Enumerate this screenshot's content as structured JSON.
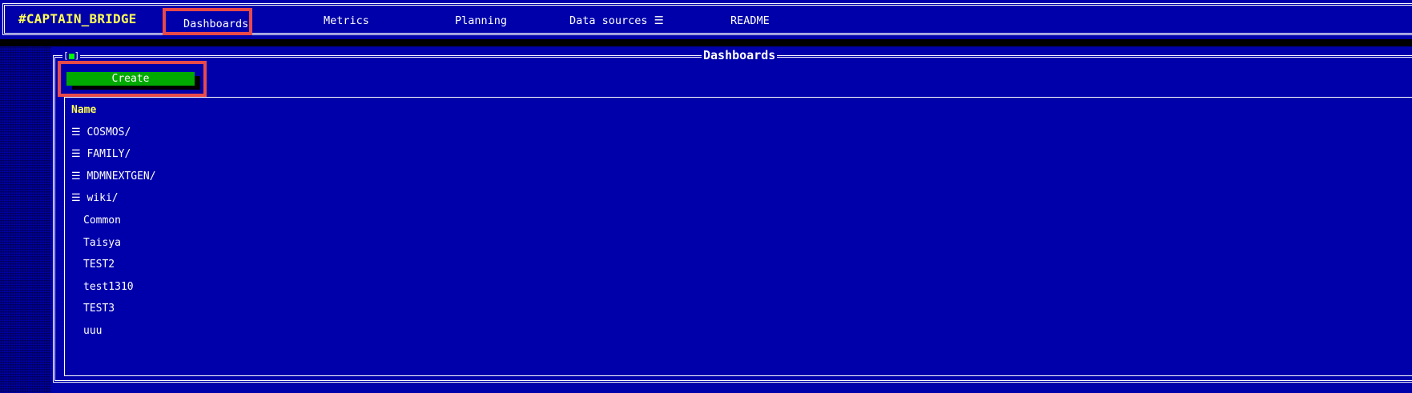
{
  "app": {
    "brand": "#CAPTAIN_BRIDGE"
  },
  "nav": {
    "dashboards": "Dashboards",
    "metrics": "Metrics",
    "planning": "Planning",
    "data_sources": "Data sources ☰",
    "readme": "README"
  },
  "panel": {
    "title": "Dashboards",
    "close_box": "[■]",
    "create_label": "Create",
    "column_header": "Name",
    "folders": [
      "☰ COSMOS/",
      "☰ FAMILY/",
      "☰ MDMNEXTGEN/",
      "☰ wiki/"
    ],
    "items": [
      "Common",
      "Taisya",
      "TEST2",
      "test1310",
      "TEST3",
      "uuu"
    ]
  },
  "colors": {
    "background": "#0000aa",
    "brand": "#ffff55",
    "button": "#00aa00",
    "highlight": "#e84a4a"
  }
}
